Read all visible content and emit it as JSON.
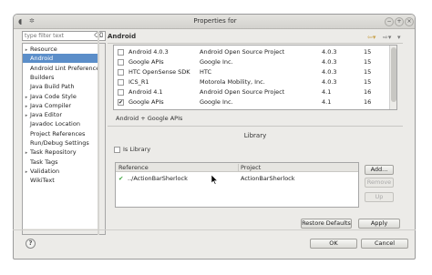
{
  "window": {
    "title": "Properties for",
    "controls": {
      "minimize": "−",
      "maximize": "+",
      "close": "×"
    }
  },
  "filter": {
    "placeholder": "type filter text",
    "clear_icon": "⌫"
  },
  "tree": {
    "items": [
      {
        "label": "Resource",
        "expandable": true,
        "selected": false
      },
      {
        "label": "Android",
        "expandable": false,
        "selected": true
      },
      {
        "label": "Android Lint Preferences",
        "expandable": false,
        "selected": false
      },
      {
        "label": "Builders",
        "expandable": false,
        "selected": false
      },
      {
        "label": "Java Build Path",
        "expandable": false,
        "selected": false
      },
      {
        "label": "Java Code Style",
        "expandable": true,
        "selected": false
      },
      {
        "label": "Java Compiler",
        "expandable": true,
        "selected": false
      },
      {
        "label": "Java Editor",
        "expandable": true,
        "selected": false
      },
      {
        "label": "Javadoc Location",
        "expandable": false,
        "selected": false
      },
      {
        "label": "Project References",
        "expandable": false,
        "selected": false
      },
      {
        "label": "Run/Debug Settings",
        "expandable": false,
        "selected": false
      },
      {
        "label": "Task Repository",
        "expandable": true,
        "selected": false
      },
      {
        "label": "Task Tags",
        "expandable": false,
        "selected": false
      },
      {
        "label": "Validation",
        "expandable": true,
        "selected": false
      },
      {
        "label": "WikiText",
        "expandable": false,
        "selected": false
      }
    ]
  },
  "page": {
    "title": "Android"
  },
  "targets": {
    "rows": [
      {
        "checked": false,
        "name": "Android 4.0.3",
        "vendor": "Android Open Source Project",
        "platform": "4.0.3",
        "api": "15"
      },
      {
        "checked": false,
        "name": "Google APIs",
        "vendor": "Google Inc.",
        "platform": "4.0.3",
        "api": "15"
      },
      {
        "checked": false,
        "name": "HTC OpenSense SDK",
        "vendor": "HTC",
        "platform": "4.0.3",
        "api": "15"
      },
      {
        "checked": false,
        "name": "ICS_R1",
        "vendor": "Motorola Mobility, Inc.",
        "platform": "4.0.3",
        "api": "15"
      },
      {
        "checked": false,
        "name": "Android 4.1",
        "vendor": "Android Open Source Project",
        "platform": "4.1",
        "api": "16"
      },
      {
        "checked": true,
        "name": "Google APIs",
        "vendor": "Google Inc.",
        "platform": "4.1",
        "api": "16"
      }
    ],
    "selected_name": "Android + Google APIs"
  },
  "library": {
    "section_title": "Library",
    "is_library_label": "Is Library",
    "is_library_checked": false,
    "columns": {
      "reference": "Reference",
      "project": "Project"
    },
    "rows": [
      {
        "status_icon": "✔",
        "reference": "../ActionBarSherlock",
        "project": "ActionBarSherlock"
      }
    ],
    "buttons": {
      "add": "Add...",
      "remove": "Remove",
      "up": "Up"
    }
  },
  "buttons": {
    "restore_defaults": "Restore Defaults",
    "apply": "Apply",
    "ok": "OK",
    "cancel": "Cancel"
  },
  "colors": {
    "selection": "#5b8ec9",
    "check_green": "#3aa33a"
  }
}
